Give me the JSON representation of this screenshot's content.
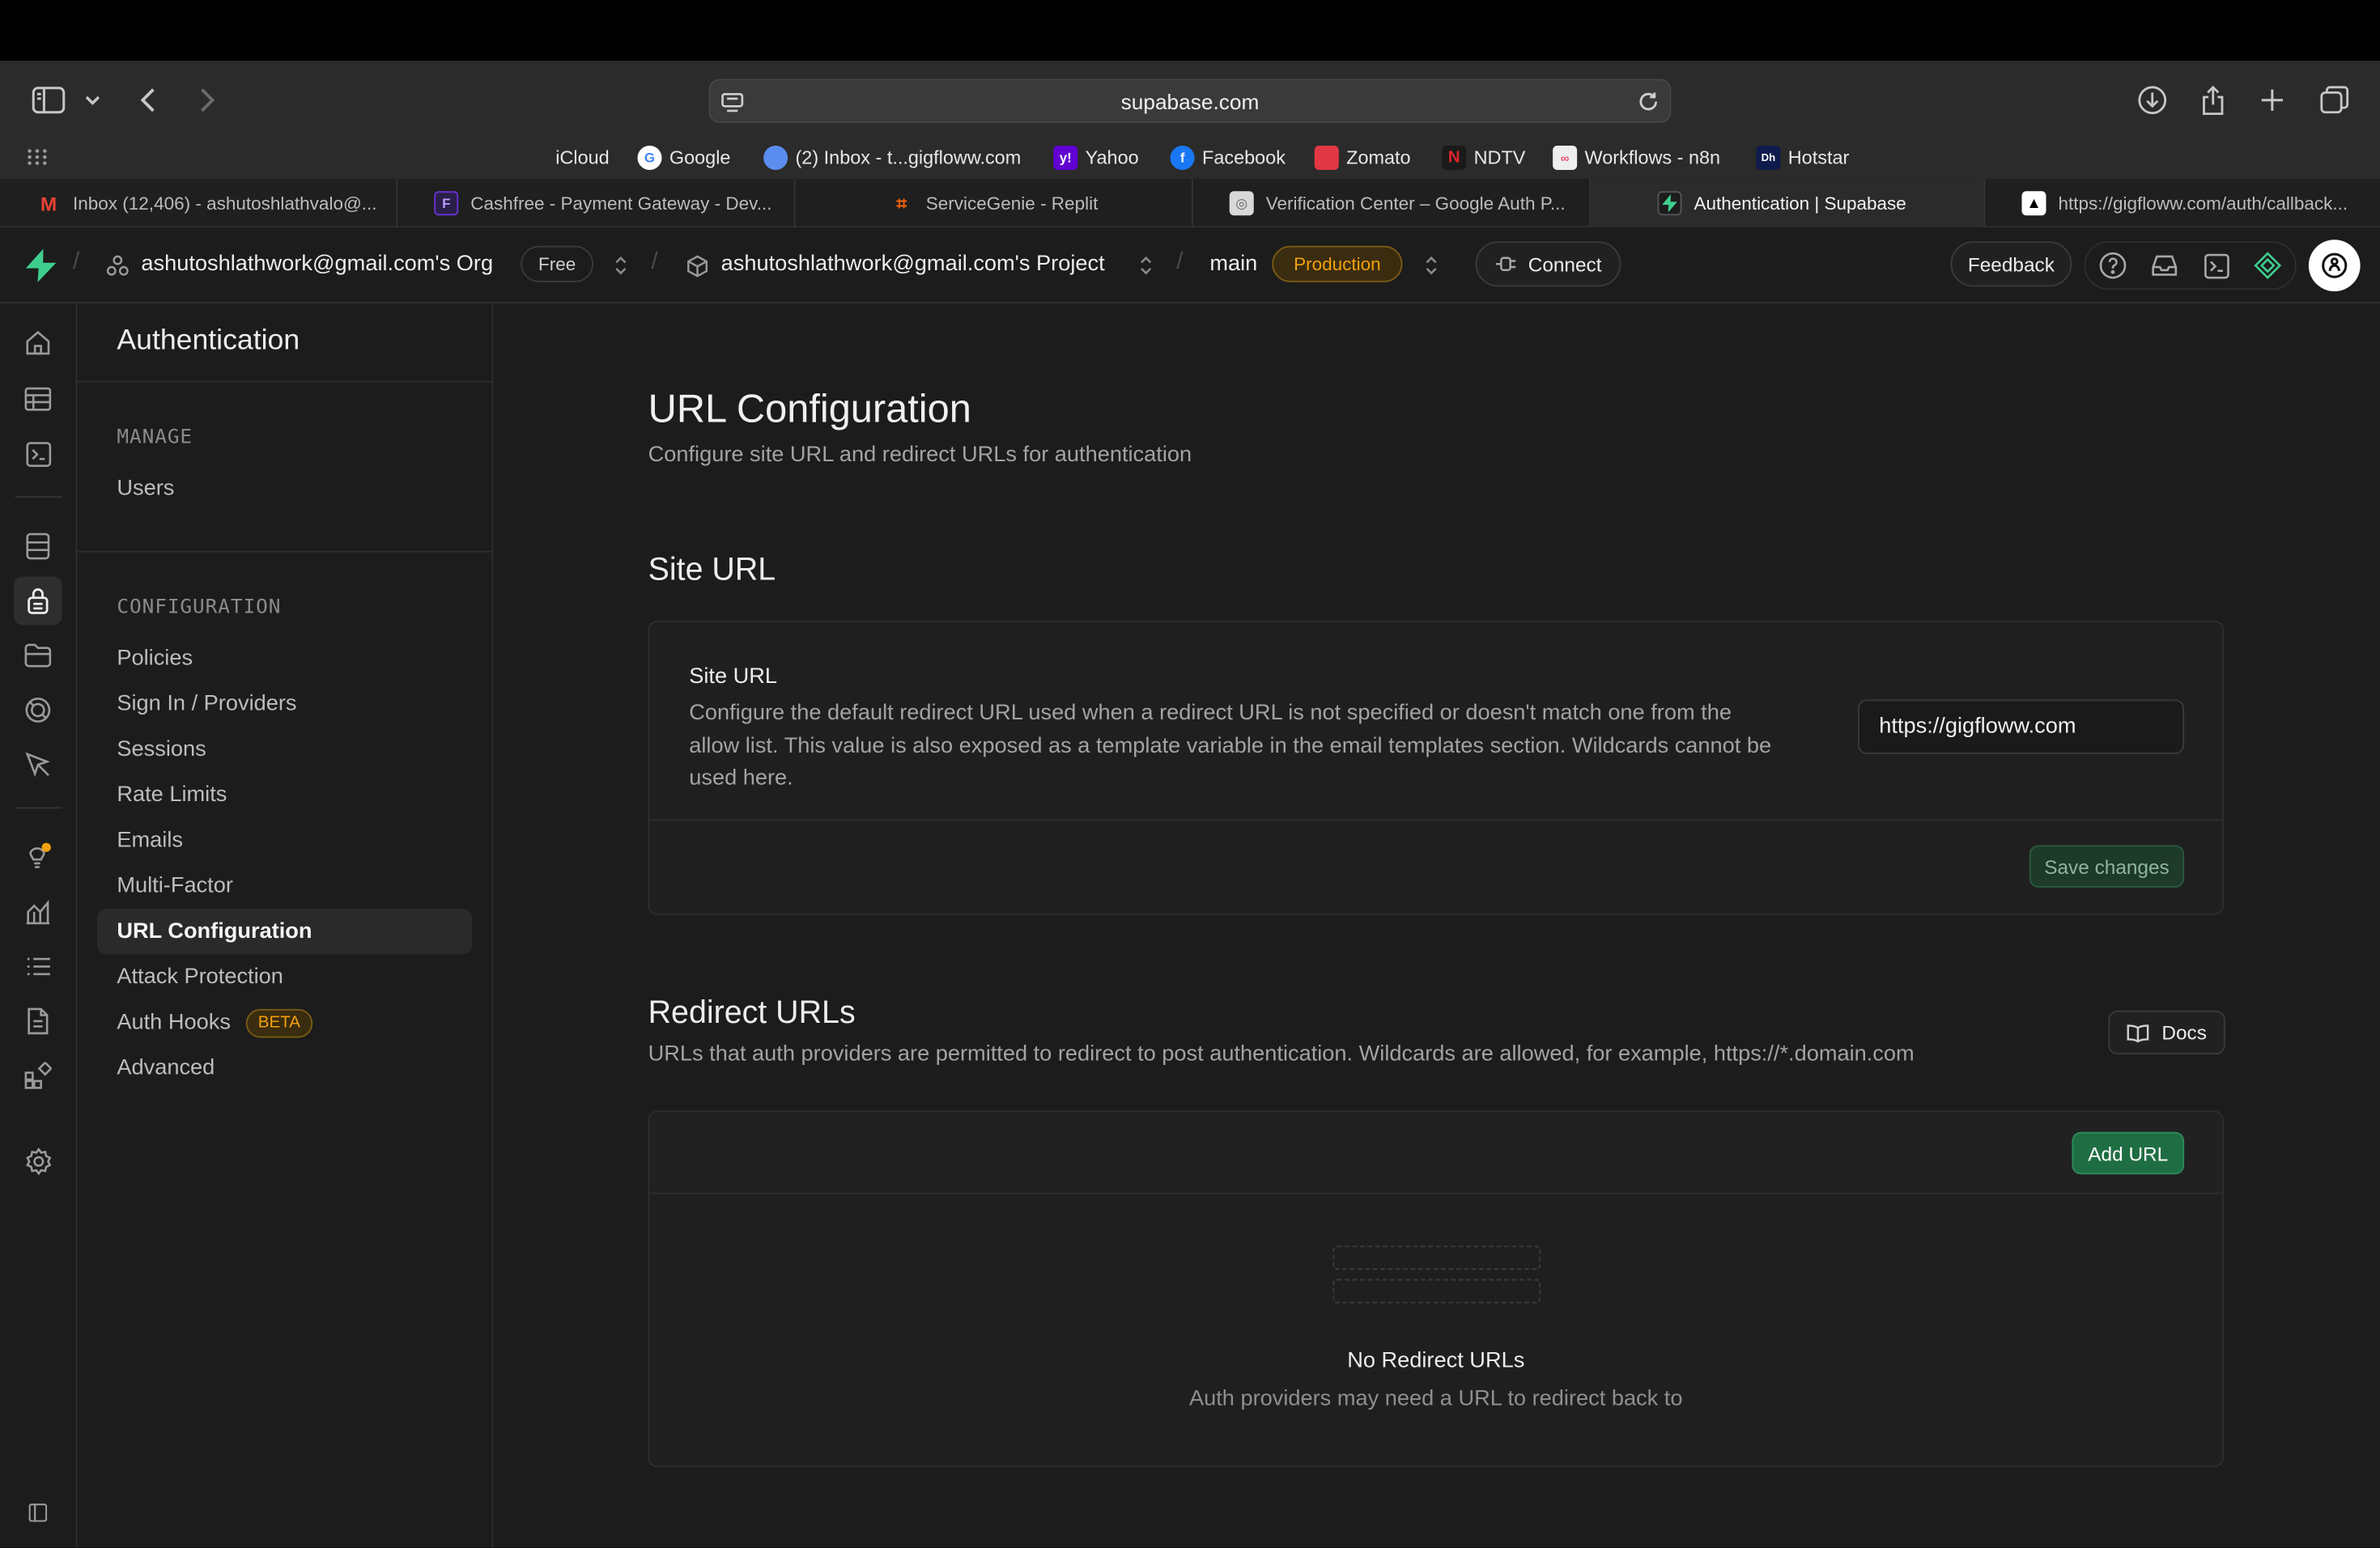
{
  "browser": {
    "url": "supabase.com",
    "bookmarks": [
      {
        "label": "iCloud",
        "icon": "apple-icon",
        "color": "#9a9a9a"
      },
      {
        "label": "Google",
        "icon": "google-icon",
        "color": "#4285f4"
      },
      {
        "label": "(2) Inbox - t...gigfloww.com",
        "icon": "inbox-icon",
        "color": "#5b8def"
      },
      {
        "label": "Yahoo",
        "icon": "yahoo-icon",
        "color": "#6001d2"
      },
      {
        "label": "Facebook",
        "icon": "facebook-icon",
        "color": "#1877f2"
      },
      {
        "label": "Zomato",
        "icon": "zomato-icon",
        "color": "#e23744"
      },
      {
        "label": "NDTV",
        "icon": "ndtv-icon",
        "color": "#c8102e"
      },
      {
        "label": "Workflows - n8n",
        "icon": "n8n-icon",
        "color": "#ea4b71"
      },
      {
        "label": "Hotstar",
        "icon": "hotstar-icon",
        "color": "#0f1b4c"
      }
    ],
    "tabs": [
      {
        "label": "Inbox (12,406) - ashutoshlathvalo@...",
        "icon": "gmail-icon",
        "color": "#ea4335",
        "active": false
      },
      {
        "label": "Cashfree - Payment Gateway - Dev...",
        "icon": "cashfree-icon",
        "color": "#6933d3",
        "active": false
      },
      {
        "label": "ServiceGenie - Replit",
        "icon": "replit-icon",
        "color": "#f26207",
        "active": false
      },
      {
        "label": "Verification Center – Google Auth P...",
        "icon": "google-auth-icon",
        "color": "#8a8a8a",
        "active": false
      },
      {
        "label": "Authentication | Supabase",
        "icon": "supabase-icon",
        "color": "#3ecf8e",
        "active": true
      },
      {
        "label": "https://gigfloww.com/auth/callback...",
        "icon": "vercel-icon",
        "color": "#ffffff",
        "active": false
      }
    ]
  },
  "header": {
    "org": "ashutoshlathwork@gmail.com's Org",
    "org_plan": "Free",
    "project": "ashutoshlathwork@gmail.com's Project",
    "branch": "main",
    "branch_env": "Production",
    "connect": "Connect",
    "feedback": "Feedback",
    "colors": {
      "accent": "#3ecf8e",
      "production": "#f1a10d"
    }
  },
  "sidemenu": {
    "title": "Authentication",
    "manage_heading": "MANAGE",
    "manage_items": [
      "Users"
    ],
    "config_heading": "CONFIGURATION",
    "config_items": [
      {
        "label": "Policies"
      },
      {
        "label": "Sign In / Providers"
      },
      {
        "label": "Sessions"
      },
      {
        "label": "Rate Limits"
      },
      {
        "label": "Emails"
      },
      {
        "label": "Multi-Factor"
      },
      {
        "label": "URL Configuration",
        "active": true
      },
      {
        "label": "Attack Protection"
      },
      {
        "label": "Auth Hooks",
        "badge": "BETA"
      },
      {
        "label": "Advanced"
      }
    ]
  },
  "main": {
    "title": "URL Configuration",
    "subtitle": "Configure site URL and redirect URLs for authentication",
    "site_url": {
      "section_title": "Site URL",
      "label": "Site URL",
      "description_lines": [
        "Configure the default redirect URL used when a redirect URL is not specified or doesn't match one from the",
        "allow list. This value is also exposed as a template variable in the email templates section. Wildcards cannot be",
        "used here."
      ],
      "value": "https://gigfloww.com",
      "save_button": "Save changes"
    },
    "redirect_urls": {
      "title": "Redirect URLs",
      "description": "URLs that auth providers are permitted to redirect to post authentication. Wildcards are allowed, for example, https://*.domain.com",
      "docs_button": "Docs",
      "add_button": "Add URL",
      "empty_title": "No Redirect URLs",
      "empty_text": "Auth providers may need a URL to redirect back to"
    }
  }
}
